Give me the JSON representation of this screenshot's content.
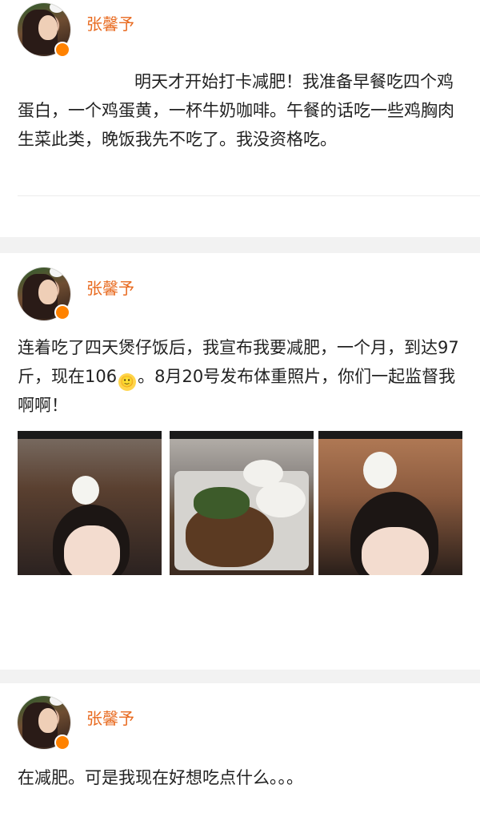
{
  "header": {
    "faded_text": ""
  },
  "posts": [
    {
      "username": "张馨予",
      "text": "明天才开始打卡减肥！我准备早餐吃四个鸡蛋白，一个鸡蛋黄，一杯牛奶咖啡。午餐的话吃一些鸡胸肉生菜此类，晚饭我先不吃了。我没资格吃。"
    },
    {
      "username": "张馨予",
      "text_before_emoji": "连着吃了四天煲仔饭后，我宣布我要减肥，一个月，到达97斤，现在106",
      "emoji": "🙂",
      "text_after_emoji": "。8月20号发布体重照片，你们一起监督我啊啊！",
      "photos": [
        "selfie-with-bunny",
        "claypot-rice",
        "selfie-with-bunny-2"
      ]
    },
    {
      "username": "张馨予",
      "text": "在减肥。可是我现在好想吃点什么。。。"
    }
  ],
  "colors": {
    "username": "#e86a1f",
    "badge": "#ff8200",
    "separator": "#f2f2f2"
  },
  "footer": {
    "watermark": ""
  }
}
